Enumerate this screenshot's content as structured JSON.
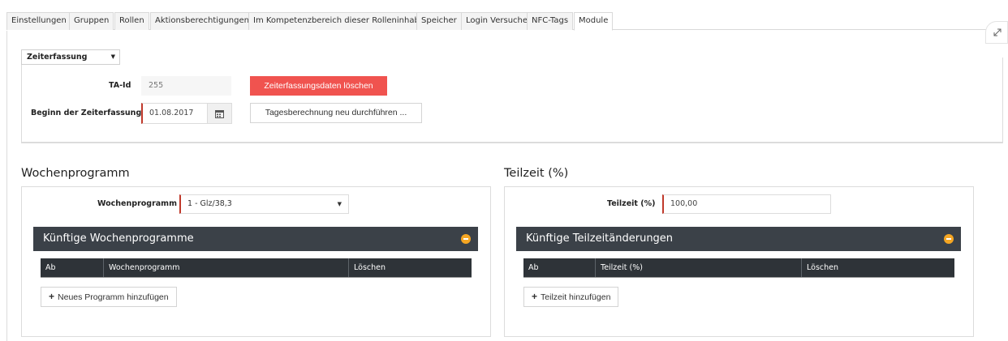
{
  "tabs": [
    {
      "label": "Einstellungen"
    },
    {
      "label": "Gruppen"
    },
    {
      "label": "Rollen"
    },
    {
      "label": "Aktionsberechtigungen"
    },
    {
      "label": "Im Kompetenzbereich dieser Rolleninhaber"
    },
    {
      "label": "Speicher"
    },
    {
      "label": "Login Versuche"
    },
    {
      "label": "NFC-Tags"
    },
    {
      "label": "Module"
    }
  ],
  "active_tab": "Module",
  "module_select": {
    "value": "Zeiterfassung"
  },
  "form": {
    "ta_id_label": "TA-Id",
    "ta_id_value": "255",
    "delete_button": "Zeiterfassungsdaten löschen",
    "start_label": "Beginn der Zeiterfassung",
    "start_value": "01.08.2017",
    "recalc_button": "Tagesberechnung neu durchführen ..."
  },
  "weekly": {
    "title": "Wochenprogramm",
    "field_label": "Wochenprogramm",
    "field_value": "1 - Glz/38,3",
    "future_title": "Künftige Wochenprogramme",
    "columns": [
      "Ab",
      "Wochenprogramm",
      "Löschen"
    ],
    "add_button": "Neues Programm hinzufügen"
  },
  "parttime": {
    "title": "Teilzeit (%)",
    "field_label": "Teilzeit (%)",
    "field_value": "100,00",
    "future_title": "Künftige Teilzeitänderungen",
    "columns": [
      "Ab",
      "Teilzeit (%)",
      "Löschen"
    ],
    "add_button": "Teilzeit hinzufügen"
  },
  "colors": {
    "danger": "#f0534f",
    "dark_header": "#3b4148",
    "toggle": "#f5a623",
    "required_marker": "#c0392b"
  },
  "icons": [
    "expand-icon",
    "calendar-icon",
    "chevron-down-icon",
    "collapse-icon",
    "plus-icon"
  ]
}
